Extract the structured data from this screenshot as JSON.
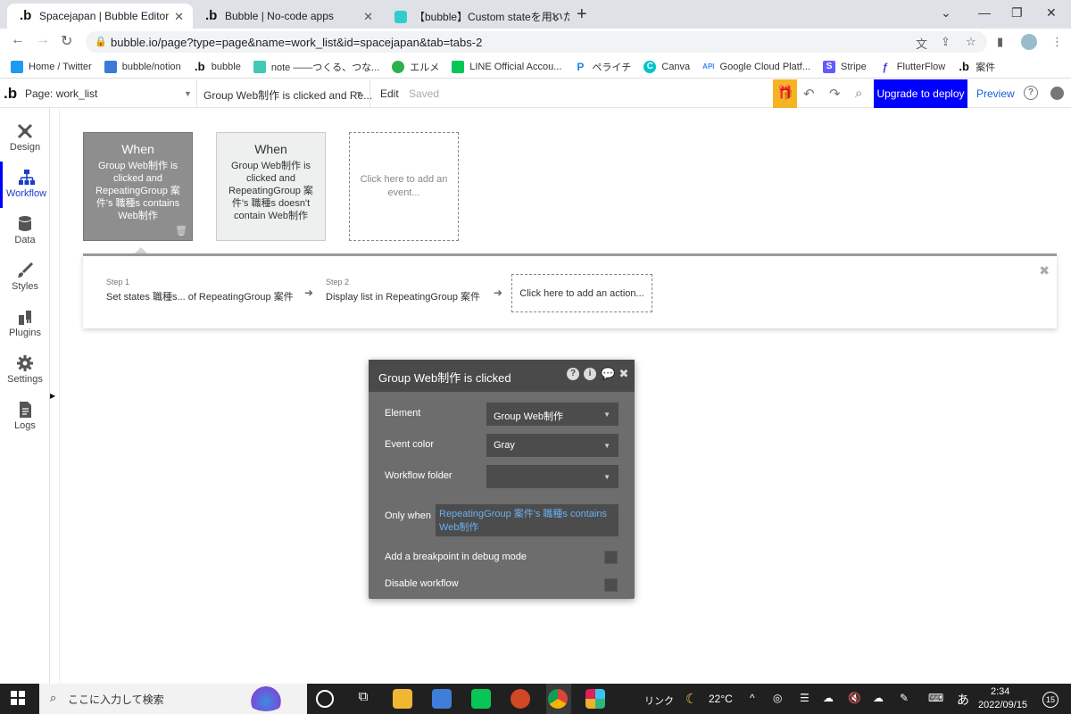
{
  "browser": {
    "tabs": [
      {
        "title": "Spacejapan | Bubble Editor",
        "icon": "bubble-icon",
        "active": true
      },
      {
        "title": "Bubble | No-code apps",
        "icon": "bubble-icon",
        "active": false
      },
      {
        "title": "【bubble】Custom stateを用いた検",
        "icon": "note-icon",
        "active": false
      }
    ],
    "url": "bubble.io/page?type=page&name=work_list&id=spacejapan&tab=tabs-2",
    "bookmarks": [
      {
        "label": "Home / Twitter",
        "color": "#1d9bf0"
      },
      {
        "label": "bubble/notion",
        "color": "#3a7bd5"
      },
      {
        "label": "bubble",
        "color": "#111111"
      },
      {
        "label": "note ――つくる、つな...",
        "color": "#41c9b4"
      },
      {
        "label": "エルメ",
        "color": "#2bb24c"
      },
      {
        "label": "LINE Official Accou...",
        "color": "#06c755"
      },
      {
        "label": "ペライチ",
        "color": "#1e88e5"
      },
      {
        "label": "Canva",
        "color": "#00c4cc"
      },
      {
        "label": "Google Cloud Platf...",
        "color": "#4285f4"
      },
      {
        "label": "Stripe",
        "color": "#635bff"
      },
      {
        "label": "FlutterFlow",
        "color": "#4b39ef"
      },
      {
        "label": "案件",
        "color": "#111111"
      }
    ],
    "api_badge": "API"
  },
  "editor": {
    "page_label": "Page: work_list",
    "event_selector": "Group Web制作 is clicked and Re...",
    "edit_label": "Edit",
    "saved_label": "Saved",
    "upgrade_label": "Upgrade to deploy",
    "preview_label": "Preview",
    "accent": "#0000ff",
    "gift_color": "#f6b324"
  },
  "sidebar": {
    "items": [
      {
        "label": "Design",
        "icon": "design-icon"
      },
      {
        "label": "Workflow",
        "icon": "workflow-icon",
        "active": true
      },
      {
        "label": "Data",
        "icon": "database-icon"
      },
      {
        "label": "Styles",
        "icon": "brush-icon"
      },
      {
        "label": "Plugins",
        "icon": "plugin-icon"
      },
      {
        "label": "Settings",
        "icon": "gear-icon"
      },
      {
        "label": "Logs",
        "icon": "document-icon"
      }
    ]
  },
  "events": [
    {
      "title": "When",
      "desc": "Group Web制作 is clicked and RepeatingGroup 案件's 職種s contains Web制作"
    },
    {
      "title": "When",
      "desc": "Group Web制作 is clicked and RepeatingGroup 案件's 職種s doesn't contain Web制作"
    }
  ],
  "add_event_label": "Click here to add an event...",
  "steps": [
    {
      "num": "Step 1",
      "text": "Set states 職種s... of RepeatingGroup 案件"
    },
    {
      "num": "Step 2",
      "text": "Display list in RepeatingGroup 案件"
    }
  ],
  "add_action_label": "Click here to add an action...",
  "panel": {
    "title": "Group Web制作 is clicked",
    "element_label": "Element",
    "element_value": "Group Web制作",
    "color_label": "Event color",
    "color_value": "Gray",
    "folder_label": "Workflow folder",
    "folder_value": "",
    "only_when_label": "Only when",
    "only_when_value": "RepeatingGroup 案件's 職種s contains Web制作",
    "breakpoint_label": "Add a breakpoint in debug mode",
    "disable_label": "Disable workflow"
  },
  "taskbar": {
    "search_placeholder": "ここに入力して検索",
    "link_label": "リンク",
    "temperature": "22°C",
    "ime": "あ",
    "time": "2:34",
    "date": "2022/09/15",
    "notifications": "15"
  }
}
